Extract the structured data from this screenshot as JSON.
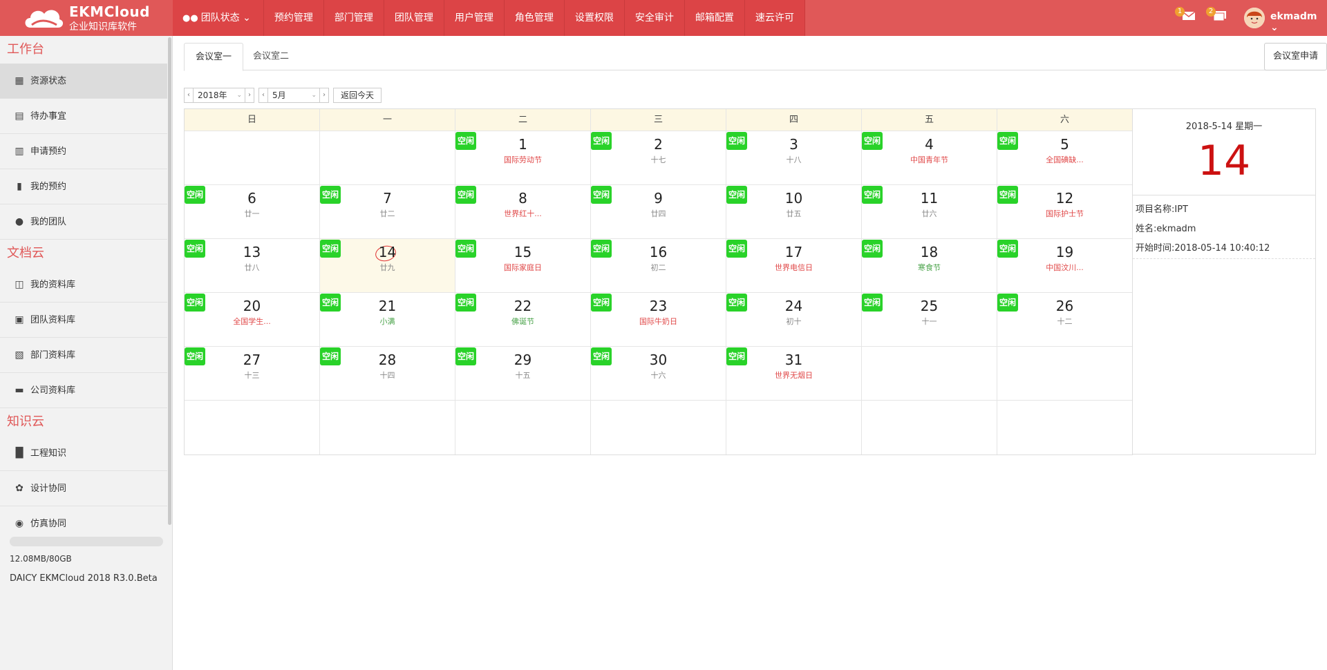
{
  "header": {
    "logo_title": "EKMCloud",
    "logo_subtitle": "企业知识库软件",
    "nav": [
      {
        "label": "团队状态",
        "icon": "team-icon",
        "dropdown": true
      },
      {
        "label": "预约管理"
      },
      {
        "label": "部门管理"
      },
      {
        "label": "团队管理"
      },
      {
        "label": "用户管理"
      },
      {
        "label": "角色管理"
      },
      {
        "label": "设置权限"
      },
      {
        "label": "安全审计"
      },
      {
        "label": "邮箱配置"
      },
      {
        "label": "速云许可"
      }
    ],
    "mail_badge": "1",
    "message_badge": "2",
    "user_name": "ekmadm"
  },
  "sidebar": {
    "groups": [
      {
        "title": "工作台",
        "items": [
          {
            "label": "资源状态",
            "icon": "resource-icon",
            "active": true
          },
          {
            "label": "待办事宜",
            "icon": "todo-icon"
          },
          {
            "label": "申请预约",
            "icon": "apply-icon"
          },
          {
            "label": "我的预约",
            "icon": "my-booking-icon"
          },
          {
            "label": "我的团队",
            "icon": "team-icon"
          }
        ]
      },
      {
        "title": "文档云",
        "items": [
          {
            "label": "我的资料库",
            "icon": "my-library-icon"
          },
          {
            "label": "团队资料库",
            "icon": "team-library-icon"
          },
          {
            "label": "部门资料库",
            "icon": "dept-library-icon"
          },
          {
            "label": "公司资料库",
            "icon": "folder-icon"
          }
        ]
      },
      {
        "title": "知识云",
        "items": [
          {
            "label": "工程知识",
            "icon": "book-icon"
          },
          {
            "label": "设计协同",
            "icon": "leaf-icon"
          },
          {
            "label": "仿真协同",
            "icon": "eye-icon"
          }
        ]
      }
    ],
    "storage": "12.08MB/80GB",
    "version": "DAICY EKMCloud 2018 R3.0.Beta"
  },
  "main": {
    "tabs": [
      {
        "label": "会议室一",
        "active": true
      },
      {
        "label": "会议室二"
      }
    ],
    "apply_button": "会议室申请",
    "year_select": "2018年",
    "month_select": "5月",
    "today_button": "返回今天",
    "weekdays": [
      "日",
      "一",
      "二",
      "三",
      "四",
      "五",
      "六"
    ],
    "free_label": "空闲",
    "weeks": [
      [
        null,
        null,
        {
          "day": "1",
          "lunar": "国际劳动节",
          "type": "festival"
        },
        {
          "day": "2",
          "lunar": "十七"
        },
        {
          "day": "3",
          "lunar": "十八"
        },
        {
          "day": "4",
          "lunar": "中国青年节",
          "type": "festival"
        },
        {
          "day": "5",
          "lunar": "全国碘缺...",
          "type": "festival"
        }
      ],
      [
        {
          "day": "6",
          "lunar": "廿一"
        },
        {
          "day": "7",
          "lunar": "廿二"
        },
        {
          "day": "8",
          "lunar": "世界红十...",
          "type": "festival"
        },
        {
          "day": "9",
          "lunar": "廿四"
        },
        {
          "day": "10",
          "lunar": "廿五"
        },
        {
          "day": "11",
          "lunar": "廿六"
        },
        {
          "day": "12",
          "lunar": "国际护士节",
          "type": "festival"
        }
      ],
      [
        {
          "day": "13",
          "lunar": "廿八"
        },
        {
          "day": "14",
          "lunar": "廿九",
          "today": true
        },
        {
          "day": "15",
          "lunar": "国际家庭日",
          "type": "festival"
        },
        {
          "day": "16",
          "lunar": "初二"
        },
        {
          "day": "17",
          "lunar": "世界电信日",
          "type": "festival"
        },
        {
          "day": "18",
          "lunar": "寒食节",
          "type": "term"
        },
        {
          "day": "19",
          "lunar": "中国汶川...",
          "type": "festival"
        }
      ],
      [
        {
          "day": "20",
          "lunar": "全国学生...",
          "type": "festival"
        },
        {
          "day": "21",
          "lunar": "小满",
          "type": "term"
        },
        {
          "day": "22",
          "lunar": "佛诞节",
          "type": "term"
        },
        {
          "day": "23",
          "lunar": "国际牛奶日",
          "type": "festival"
        },
        {
          "day": "24",
          "lunar": "初十"
        },
        {
          "day": "25",
          "lunar": "十一"
        },
        {
          "day": "26",
          "lunar": "十二"
        }
      ],
      [
        {
          "day": "27",
          "lunar": "十三"
        },
        {
          "day": "28",
          "lunar": "十四"
        },
        {
          "day": "29",
          "lunar": "十五"
        },
        {
          "day": "30",
          "lunar": "十六"
        },
        {
          "day": "31",
          "lunar": "世界无烟日",
          "type": "festival"
        },
        null,
        null
      ],
      [
        null,
        null,
        null,
        null,
        null,
        null,
        null
      ]
    ],
    "detail": {
      "date": "2018-5-14  星期一",
      "day": "14",
      "project": "项目名称:IPT",
      "name": "姓名:ekmadm",
      "start": "开始时间:2018-05-14 10:40:12"
    }
  },
  "colors": {
    "brand": "#e05858",
    "free": "#29d229",
    "festival": "#e04848",
    "today_day": "#cc1111"
  }
}
